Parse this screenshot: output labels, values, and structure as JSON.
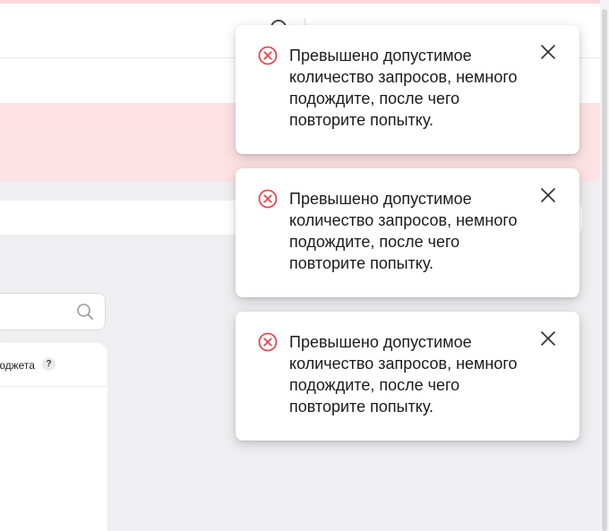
{
  "colors": {
    "error_red": "#e5484d",
    "banner_pink": "#fde2e4",
    "background": "#efeff2"
  },
  "background_page": {
    "widget_title": "бюджета",
    "help_badge": "?"
  },
  "toasts": [
    {
      "message": "Превышено допустимое количество запросов, немного подождите, после чего повторите попытку.",
      "status_icon": "error-circle-x-icon",
      "close_icon": "close-icon"
    },
    {
      "message": "Превышено допустимое количество запросов, немного подождите, после чего повторите попытку.",
      "status_icon": "error-circle-x-icon",
      "close_icon": "close-icon"
    },
    {
      "message": "Превышено допустимое количество запросов, немного подождите, после чего повторите попытку.",
      "status_icon": "error-circle-x-icon",
      "close_icon": "close-icon"
    }
  ]
}
